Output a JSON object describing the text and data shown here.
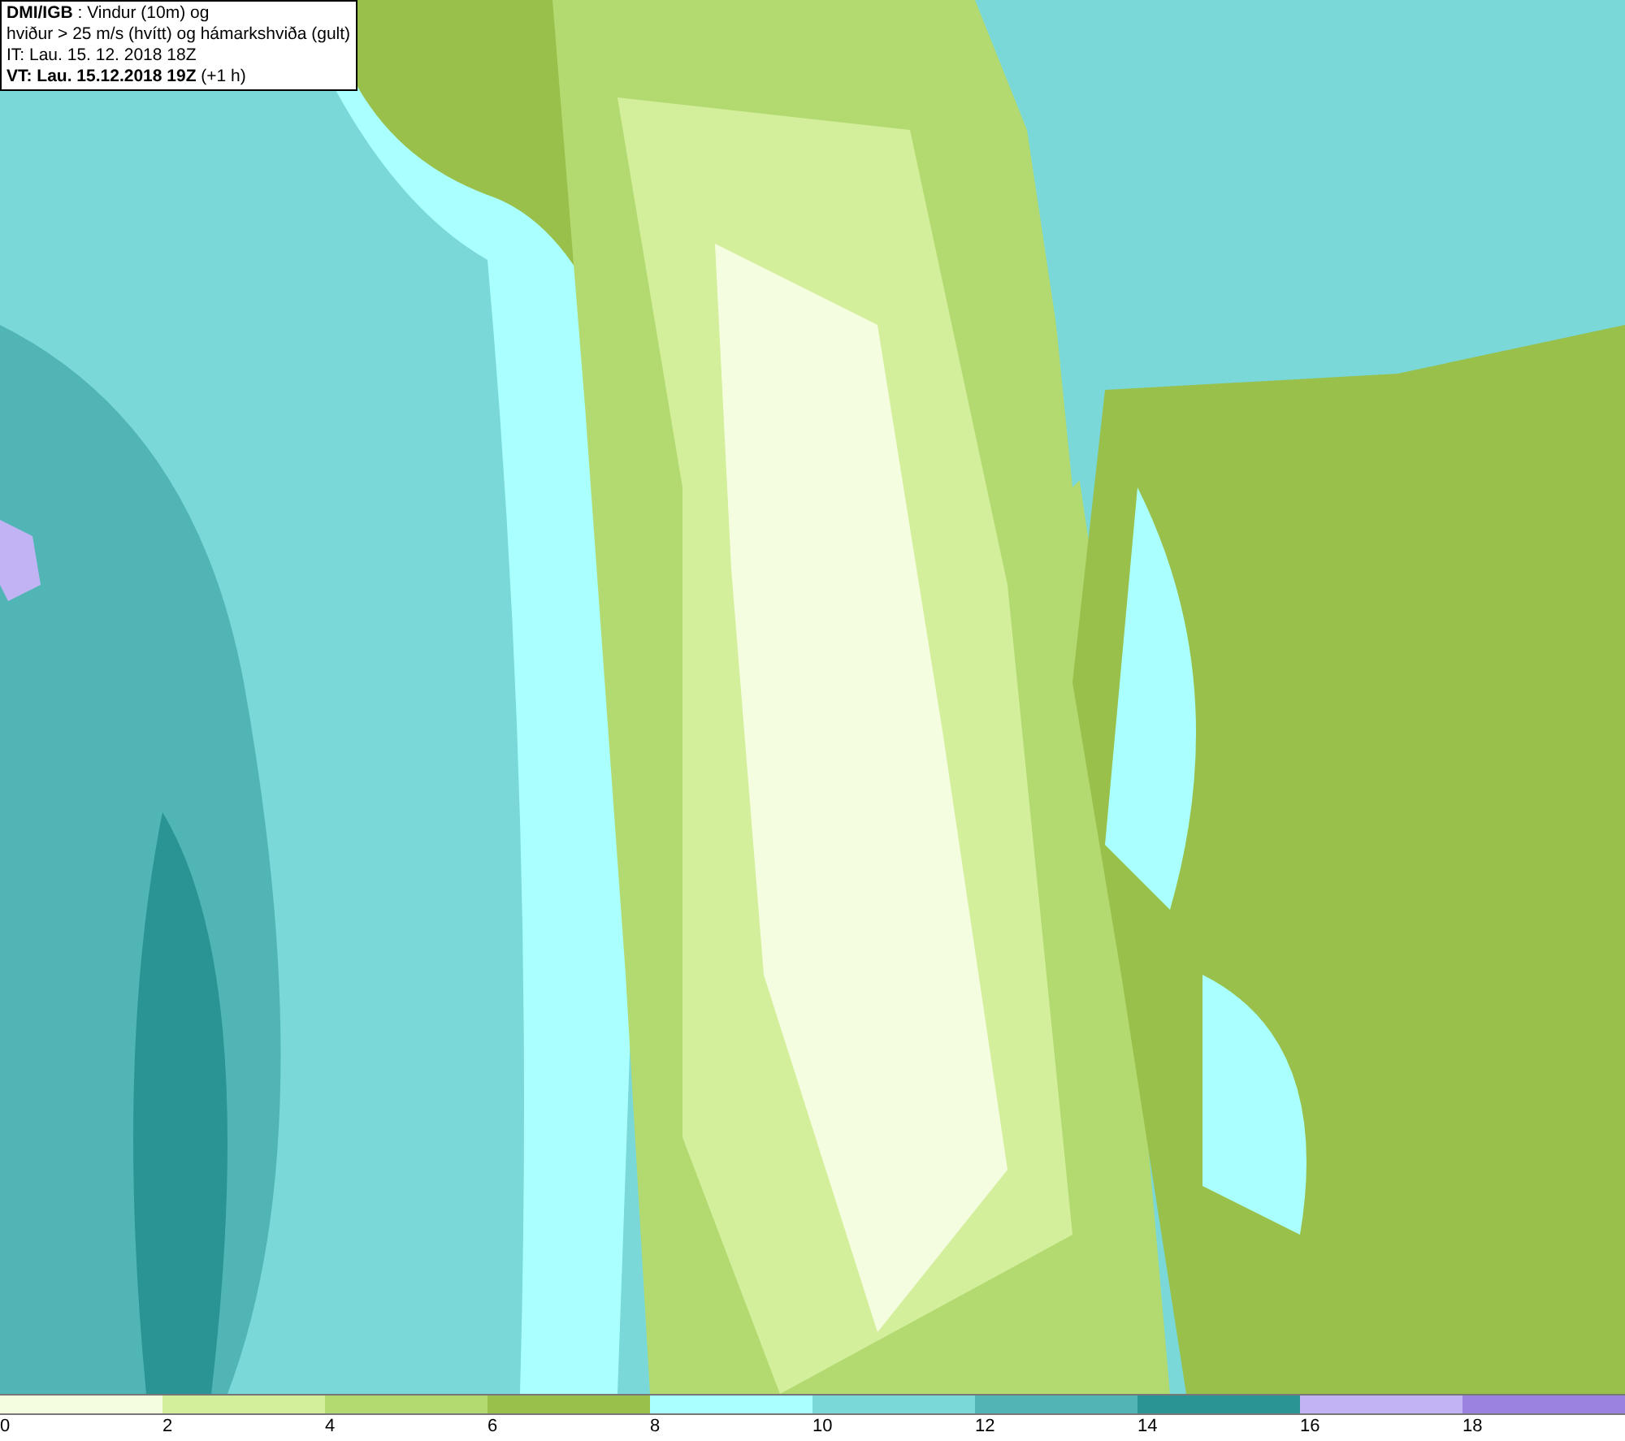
{
  "header": {
    "lines": [
      "**DMI/IGB** : Vindur (10m) og",
      "hviður > 25 m/s (hvítt) og hámarkshviða (gult)",
      "IT: Lau. 15. 12. 2018 18Z",
      "**VT: Lau. 15.12.2018 19Z** (+1 h)"
    ]
  },
  "legend": {
    "bins": [
      {
        "label": "0",
        "color": "#f5fde0"
      },
      {
        "label": "2",
        "color": "#d4ef9c"
      },
      {
        "label": "4",
        "color": "#b3da70"
      },
      {
        "label": "6",
        "color": "#99c04a"
      },
      {
        "label": "8",
        "color": "#aaffff"
      },
      {
        "label": "10",
        "color": "#7ad8d8"
      },
      {
        "label": "12",
        "color": "#52b5b5"
      },
      {
        "label": "14",
        "color": "#2a9494"
      },
      {
        "label": "16",
        "color": "#c2b3f5"
      },
      {
        "label": "18",
        "color": "#9c82e0"
      }
    ]
  }
}
